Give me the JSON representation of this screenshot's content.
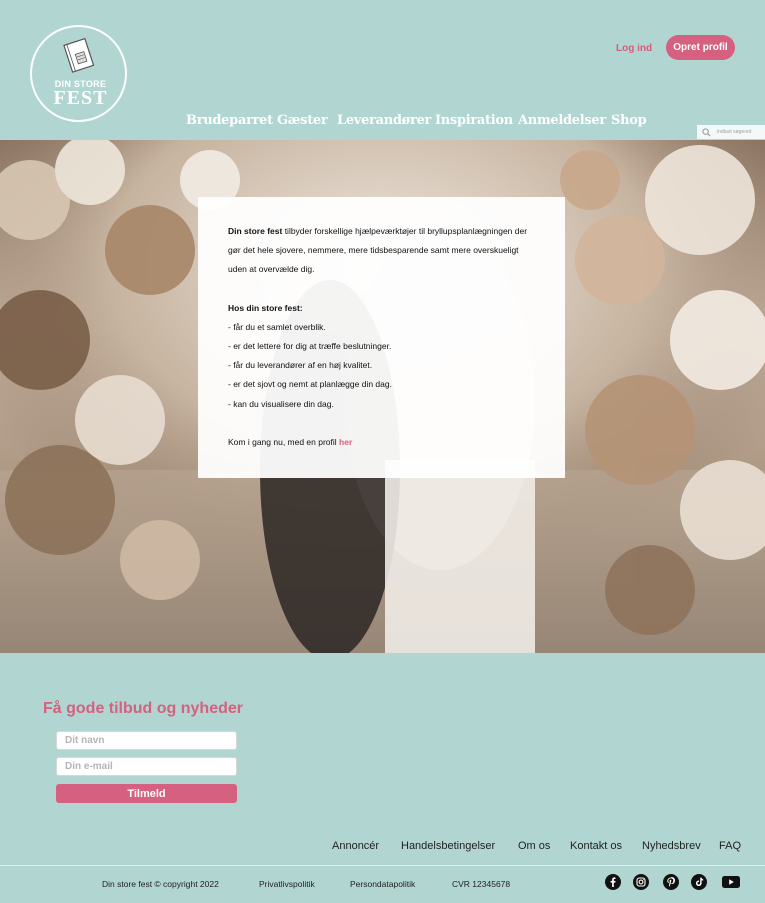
{
  "brand": {
    "line1": "DIN STORE",
    "line2": "FEST"
  },
  "header": {
    "login": "Log ind",
    "signup": "Opret profil"
  },
  "nav": [
    {
      "label": "Brudeparret"
    },
    {
      "label": "Gæster"
    },
    {
      "label": "Leverandører"
    },
    {
      "label": "Inspiration"
    },
    {
      "label": "Anmeldelser"
    },
    {
      "label": "Shop"
    }
  ],
  "search": {
    "placeholder": "indtast søgeord"
  },
  "intro": {
    "p1_bold": "Din store fest",
    "p1_rest": " tilbyder forskellige hjælpeværktøjer til bryllupsplanlægningen der gør det hele sjovere, nemmere, mere tidsbesparende samt mere overskueligt uden at overvælde dig.",
    "list_title": "Hos din store fest:",
    "items": [
      "- får du et samlet overblik.",
      "- er det lettere for dig at træffe beslutninger.",
      "- får du leverandører af en høj kvalitet.",
      "- er det sjovt og nemt at planlægge din dag.",
      "- kan du visualisere din dag."
    ],
    "cta_text": "Kom i gang nu, med en profil ",
    "cta_link": "her"
  },
  "newsletter": {
    "title": "Få gode tilbud og nyheder",
    "name_placeholder": "Dit navn",
    "email_placeholder": "Din e-mail",
    "button": "Tilmeld"
  },
  "footer": {
    "links": [
      "Annoncér",
      "Handelsbetingelser",
      "Om os",
      "Kontakt os",
      "Nyhedsbrev",
      "FAQ"
    ],
    "copyright": "Din store fest © copyright 2022",
    "privacy": "Privatlivspolitik",
    "data_policy": "Persondatapolitik",
    "cvr": "CVR 12345678",
    "social": [
      "facebook-icon",
      "instagram-icon",
      "pinterest-icon",
      "tiktok-icon",
      "youtube-icon"
    ]
  },
  "colors": {
    "background": "#b1d6d2",
    "accent": "#d5607f"
  }
}
